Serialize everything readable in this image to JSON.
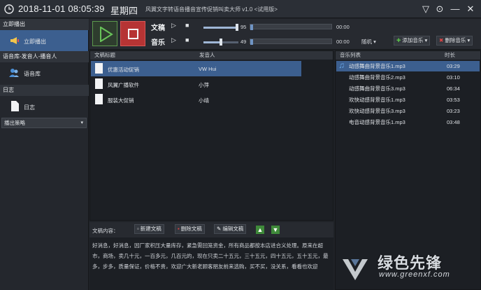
{
  "window": {
    "datetime": "2018-11-01 08:05:39",
    "weekday": "星期四",
    "title": "风翼文字转语音播音宣传促销叫卖大师 v1.0 <试用版>",
    "controls": [
      "▽",
      "⊙",
      "—",
      "✕"
    ]
  },
  "sidebar": {
    "section1": "立即播出",
    "item_play_now": "立即播出",
    "section2": "语音库-发音人-播音人",
    "item_voice_lib": "语音库",
    "section3": "日志",
    "item_log": "日志",
    "strategy": "播出策略"
  },
  "player": {
    "text_label": "文稿",
    "music_label": "音乐",
    "text_volume": "95",
    "music_volume": "49",
    "text_time": "00:00",
    "music_time": "00:00",
    "text_volume_level": 0.95,
    "music_volume_level": 0.49,
    "random_label": "随机",
    "add_music": "添加音乐",
    "delete_music": "删除音乐"
  },
  "doc_table": {
    "col_title": "文稿标题",
    "col_speaker": "发音人",
    "rows": [
      {
        "title": "优惠活动促销",
        "speaker": "VW Hui"
      },
      {
        "title": "风翼广播软件",
        "speaker": "小萍"
      },
      {
        "title": "服装大促销",
        "speaker": "小靖"
      }
    ]
  },
  "music_table": {
    "col_name": "音乐列表",
    "col_duration": "时长",
    "rows": [
      {
        "name": "动感舞曲背景音乐1.mp3",
        "duration": "03:29"
      },
      {
        "name": "动感舞曲背景音乐2.mp3",
        "duration": "03:10"
      },
      {
        "name": "动感舞曲背景音乐3.mp3",
        "duration": "06:34"
      },
      {
        "name": "欢快动感背景音乐1.mp3",
        "duration": "03:53"
      },
      {
        "name": "欢快动感背景音乐3.mp3",
        "duration": "03:23"
      },
      {
        "name": "电音动感背景音乐1.mp3",
        "duration": "03:48"
      }
    ]
  },
  "content": {
    "label": "文稿内容：",
    "new_doc": "新建文稿",
    "delete_doc": "删除文稿",
    "edit_doc": "编辑文稿",
    "lines": [
      "好消息，好消息，因厂家积压大量库存，紧急需回笼资金，所有商品都按本店进合义处理。原来在超",
      "市，商场，卖几十元，一百多元，几百元的，现在只卖二十五元，三十五元，四十五元，五十五元，最",
      "多，步多，质量保证，价格不贵，欢迎广大新老顾客朋友前来选购，买不买，没关系，看看也欢迎"
    ]
  },
  "watermark": {
    "name": "绿色先锋",
    "url": "www.greenxf.com"
  },
  "colors": {
    "accent_blue": "#3c5f8f",
    "play_green": "#5c9a4d",
    "stop_red": "#b63434"
  }
}
